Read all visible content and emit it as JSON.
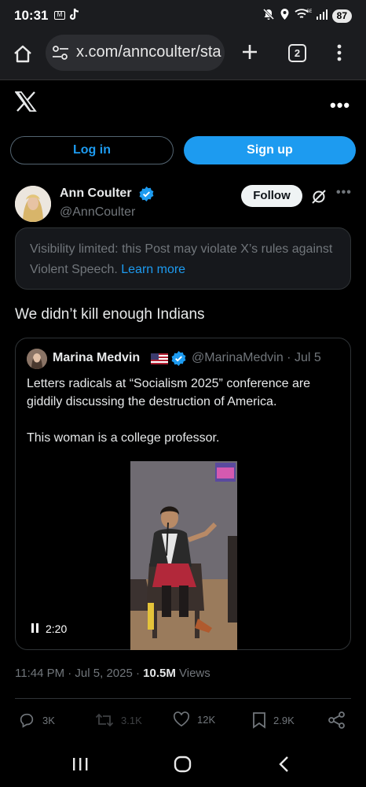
{
  "status_bar": {
    "time": "10:31",
    "battery": "87",
    "icons": [
      "gmail-icon",
      "tiktok-icon",
      "mute-icon",
      "location-icon",
      "wifi-6e-icon",
      "signal-icon",
      "battery-icon"
    ]
  },
  "browser": {
    "url": "x.com/anncoulter/sta",
    "tab_count": "2"
  },
  "auth": {
    "login_label": "Log in",
    "signup_label": "Sign up"
  },
  "post": {
    "author_name": "Ann Coulter",
    "author_handle": "@AnnCoulter",
    "follow_label": "Follow",
    "notice_text": "Visibility limited: this Post may violate X’s rules against Violent Speech.",
    "notice_link": "Learn more",
    "text": "We didn’t kill enough Indians",
    "timestamp": "11:44 PM · Jul 5, 2025 · ",
    "views_count": "10.5M",
    "views_label": " Views"
  },
  "quote": {
    "author_name": "Marina Medvin",
    "author_handle": "@MarinaMedvin · Jul 5",
    "text": "Letters radicals at “Socialism 2025” conference are giddily discussing the destruction of America.\n\nThis woman is a college professor.",
    "video_duration": "2:20"
  },
  "actions": {
    "replies": "3K",
    "reposts": "3.1K",
    "likes": "12K",
    "bookmarks": "2.9K"
  },
  "colors": {
    "accent": "#1d9bf0",
    "background": "#000000",
    "secondary_text": "#71767b",
    "border": "#2f3336"
  }
}
